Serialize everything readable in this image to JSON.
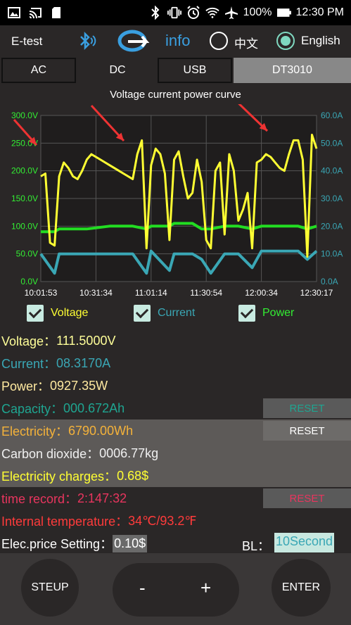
{
  "status_bar": {
    "battery": "100%",
    "time": "12:30 PM"
  },
  "header": {
    "title": "E-test",
    "info_label": "info",
    "lang_chinese": "中文",
    "lang_english": "English",
    "selected_language": "English"
  },
  "tabs": [
    {
      "label": "AC"
    },
    {
      "label": "DC"
    },
    {
      "label": "USB"
    },
    {
      "label": "DT3010"
    }
  ],
  "active_tab": "DC",
  "chart_data": {
    "type": "line",
    "title": "Voltage current power curve",
    "x_ticks": [
      "10:01:53",
      "10:31:34",
      "11:01:14",
      "11:30:54",
      "12:00:34",
      "12:30:17"
    ],
    "y_left_ticks": [
      "0.0V",
      "50.0V",
      "100.0V",
      "150.0V",
      "200.0V",
      "250.0V",
      "300.0V"
    ],
    "y_right_ticks": [
      "0.0A",
      "10.0A",
      "20.0A",
      "30.0A",
      "40.0A",
      "50.0A",
      "60.0A"
    ],
    "ylim_left": [
      0,
      300
    ],
    "ylim_right": [
      0,
      60
    ],
    "grid": true,
    "colors": {
      "voltage": "#ffff33",
      "current": "#3aa7b5",
      "power": "#22dd22",
      "left_axis": "#33ee33",
      "right_axis": "#3aa7b5",
      "arrow": "#ee3333"
    },
    "series": [
      {
        "name": "Voltage",
        "axis": "left",
        "x": [
          0,
          1,
          2,
          3,
          4,
          5,
          6,
          7,
          8,
          9,
          10,
          11,
          12,
          13,
          14,
          15,
          16,
          17,
          18,
          19,
          20,
          21,
          22,
          23,
          24,
          25,
          26,
          27,
          28,
          29,
          30,
          31,
          32,
          33,
          34,
          35,
          36,
          37,
          38,
          39,
          40,
          41,
          42,
          43,
          44,
          45,
          46,
          47,
          48,
          49,
          50,
          51,
          52,
          53,
          54,
          55,
          56,
          57,
          58,
          59,
          60
        ],
        "values": [
          190,
          195,
          70,
          65,
          190,
          215,
          205,
          190,
          185,
          200,
          220,
          230,
          225,
          220,
          215,
          210,
          205,
          200,
          195,
          190,
          185,
          230,
          255,
          60,
          210,
          240,
          230,
          195,
          75,
          220,
          235,
          190,
          150,
          160,
          220,
          180,
          75,
          60,
          200,
          215,
          85,
          230,
          200,
          110,
          130,
          160,
          60,
          215,
          220,
          230,
          225,
          215,
          205,
          200,
          230,
          255,
          255,
          220,
          45,
          265,
          240
        ]
      },
      {
        "name": "Current",
        "axis": "right",
        "x": [
          0,
          3,
          4,
          6,
          10,
          15,
          20,
          23,
          24,
          28,
          29,
          33,
          35,
          37,
          40,
          43,
          46,
          48,
          52,
          56,
          58,
          60
        ],
        "values": [
          10,
          3,
          10,
          10,
          10,
          10,
          10,
          3,
          11,
          4,
          10,
          10,
          8,
          3,
          10,
          10,
          5,
          11,
          11,
          11,
          8,
          11
        ]
      },
      {
        "name": "Power",
        "axis": "right",
        "x": [
          0,
          3,
          4,
          6,
          10,
          15,
          20,
          23,
          24,
          28,
          29,
          33,
          35,
          37,
          40,
          43,
          46,
          48,
          52,
          56,
          58,
          60
        ],
        "values": [
          18,
          18,
          19,
          19,
          19,
          20,
          20,
          19,
          20,
          20,
          21,
          21,
          19,
          19,
          20,
          20,
          19,
          20,
          20,
          20,
          19,
          20
        ]
      }
    ]
  },
  "legend": [
    {
      "label": "Voltage",
      "checked": true
    },
    {
      "label": "Current",
      "checked": true
    },
    {
      "label": "Power",
      "checked": true
    }
  ],
  "readings": {
    "voltage_label": "Voltage：",
    "voltage_value": "111.5000V",
    "current_label": "Current：",
    "current_value": "08.3170A",
    "power_label": "Power：",
    "power_value": "0927.35W",
    "capacity_label": "Capacity：",
    "capacity_value": "000.672Ah",
    "electricity_label": "Electricity：",
    "electricity_value": "6790.00Wh",
    "co2_label": "Carbon dioxide：",
    "co2_value": "0006.77kg",
    "charges_label": "Electricity charges：",
    "charges_value": "0.68$",
    "time_label": "time record：",
    "time_value": "2:147:32",
    "temp_label": "Internal temperature：",
    "temp_value": "34℃/93.2℉",
    "price_label": "Elec.price Setting：",
    "price_value": "0.10$",
    "bl_label": "BL：",
    "bl_value": "10Second",
    "reset_label": "RESET"
  },
  "buttons": {
    "setup": "STEUP",
    "minus": "-",
    "plus": "+",
    "enter": "ENTER"
  }
}
